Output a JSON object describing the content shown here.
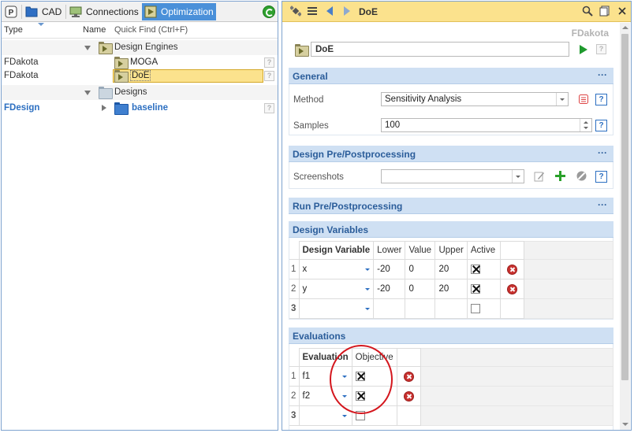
{
  "left_panel": {
    "tabs": [
      {
        "label": "",
        "icon": "p-icon"
      },
      {
        "label": "CAD",
        "icon": "cad-folder-icon"
      },
      {
        "label": "Connections",
        "icon": "monitor-icon"
      },
      {
        "label": "Optimization",
        "icon": "optimization-icon",
        "active": true
      }
    ],
    "columns": {
      "type": "Type",
      "name": "Name",
      "quick_find_placeholder": "Quick Find (Ctrl+F)"
    },
    "tree": {
      "design_engines_label": "Design Engines",
      "engines": [
        {
          "type": "FDakota",
          "name": "MOGA",
          "help": "?"
        },
        {
          "type": "FDakota",
          "name": "DoE",
          "help": "?",
          "selected": true
        }
      ],
      "designs_label": "Designs",
      "designs": [
        {
          "type": "FDesign",
          "name": "baseline",
          "help": "?"
        }
      ]
    }
  },
  "right_panel": {
    "title": "DoE",
    "owner": "FDakota",
    "name_value": "DoE",
    "help": "?",
    "sections": {
      "general": {
        "title": "General",
        "dots": "···",
        "method_label": "Method",
        "method_value": "Sensitivity Analysis",
        "samples_label": "Samples",
        "samples_value": "100",
        "help": "?"
      },
      "prepost": {
        "title": "Design Pre/Postprocessing",
        "dots": "···",
        "screenshots_label": "Screenshots",
        "screenshots_value": "",
        "help": "?"
      },
      "run_prepost": {
        "title": "Run Pre/Postprocessing",
        "dots": "···"
      },
      "design_variables": {
        "title": "Design Variables",
        "headers": [
          "Design Variable",
          "Lower",
          "Value",
          "Upper",
          "Active"
        ],
        "rows": [
          {
            "n": "1",
            "name": "x",
            "lower": "-20",
            "value": "0",
            "upper": "20",
            "active": true
          },
          {
            "n": "2",
            "name": "y",
            "lower": "-20",
            "value": "0",
            "upper": "20",
            "active": true
          },
          {
            "n": "3",
            "name": "",
            "lower": "",
            "value": "",
            "upper": "",
            "active": false
          }
        ]
      },
      "evaluations": {
        "title": "Evaluations",
        "headers": [
          "Evaluation",
          "Objective"
        ],
        "rows": [
          {
            "n": "1",
            "name": "f1",
            "objective": true
          },
          {
            "n": "2",
            "name": "f2",
            "objective": true
          },
          {
            "n": "3",
            "name": "",
            "objective": false
          }
        ]
      }
    }
  },
  "colors": {
    "accent": "#4a90d9",
    "header_yellow": "#fbe28d",
    "section_blue": "#cfe0f3",
    "annotation_red": "#d4161d"
  }
}
